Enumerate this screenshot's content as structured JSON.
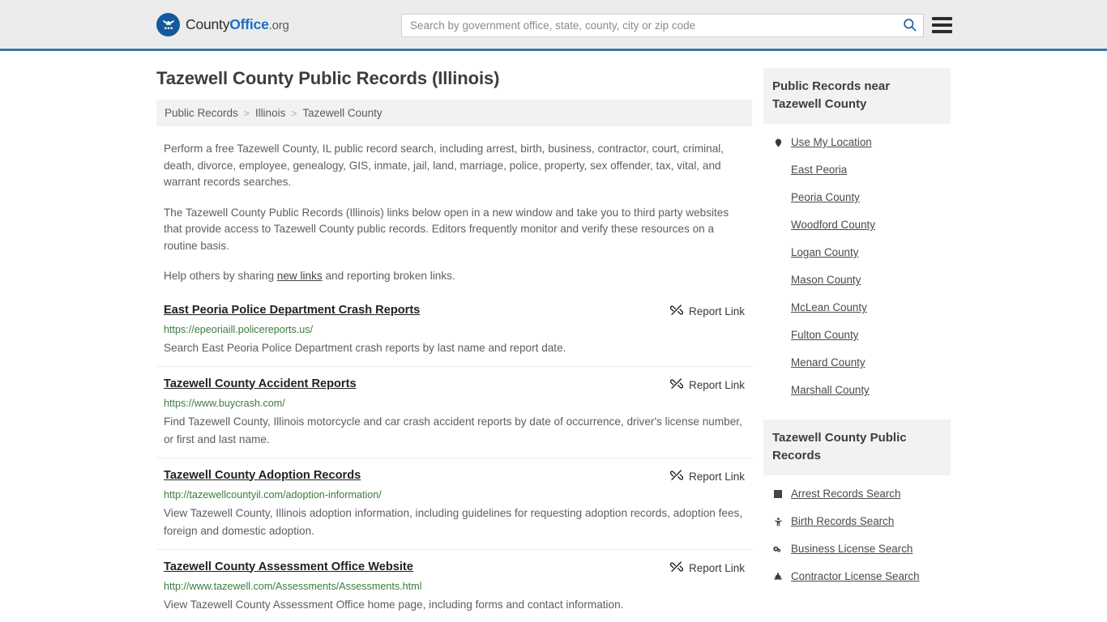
{
  "header": {
    "logo": {
      "icon": "eagle-shield-icon",
      "text_county": "County",
      "text_office": "Office",
      "text_tld": ".org"
    },
    "search": {
      "placeholder": "Search by government office, state, county, city or zip code",
      "value": "",
      "search_icon": "search-icon"
    },
    "menu_icon": "hamburger-menu-icon"
  },
  "main": {
    "title": "Tazewell County Public Records (Illinois)",
    "breadcrumb": [
      {
        "label": "Public Records"
      },
      {
        "label": "Illinois"
      },
      {
        "label": "Tazewell County"
      }
    ],
    "breadcrumb_separator": ">",
    "intro": {
      "p1": "Perform a free Tazewell County, IL public record search, including arrest, birth, business, contractor, court, criminal, death, divorce, employee, genealogy, GIS, inmate, jail, land, marriage, police, property, sex offender, tax, vital, and warrant records searches.",
      "p2": "The Tazewell County Public Records (Illinois) links below open in a new window and take you to third party websites that provide access to Tazewell County public records. Editors frequently monitor and verify these resources on a routine basis.",
      "p3_before": "Help others by sharing ",
      "p3_link": "new links",
      "p3_after": " and reporting broken links."
    },
    "report_link_label": "Report Link",
    "report_link_icon": "broken-link-icon",
    "results": [
      {
        "title": "East Peoria Police Department Crash Reports",
        "url": "https://epeoriaill.policereports.us/",
        "description": "Search East Peoria Police Department crash reports by last name and report date."
      },
      {
        "title": "Tazewell County Accident Reports",
        "url": "https://www.buycrash.com/",
        "description": "Find Tazewell County, Illinois motorcycle and car crash accident reports by date of occurrence, driver's license number, or first and last name."
      },
      {
        "title": "Tazewell County Adoption Records",
        "url": "http://tazewellcountyil.com/adoption-information/",
        "description": "View Tazewell County, Illinois adoption information, including guidelines for requesting adoption records, adoption fees, foreign and domestic adoption."
      },
      {
        "title": "Tazewell County Assessment Office Website",
        "url": "http://www.tazewell.com/Assessments/Assessments.html",
        "description": "View Tazewell County Assessment Office home page, including forms and contact information."
      }
    ]
  },
  "sidebar": {
    "near_box": {
      "heading": "Public Records near Tazewell County",
      "items": [
        {
          "label": "Use My Location",
          "icon": "map-pin-icon"
        },
        {
          "label": "East Peoria",
          "icon": ""
        },
        {
          "label": "Peoria County",
          "icon": ""
        },
        {
          "label": "Woodford County",
          "icon": ""
        },
        {
          "label": "Logan County",
          "icon": ""
        },
        {
          "label": "Mason County",
          "icon": ""
        },
        {
          "label": "McLean County",
          "icon": ""
        },
        {
          "label": "Fulton County",
          "icon": ""
        },
        {
          "label": "Menard County",
          "icon": ""
        },
        {
          "label": "Marshall County",
          "icon": ""
        }
      ]
    },
    "records_box": {
      "heading": "Tazewell County Public Records",
      "items": [
        {
          "label": "Arrest Records Search",
          "icon": "fingerprint-square-icon"
        },
        {
          "label": "Birth Records Search",
          "icon": "child-icon"
        },
        {
          "label": "Business License Search",
          "icon": "gears-icon"
        },
        {
          "label": "Contractor License Search",
          "icon": "hard-hat-icon"
        }
      ]
    }
  },
  "colors": {
    "header_bg": "#ececec",
    "header_rule": "#3f77a7",
    "brand_blue": "#1b6fc4",
    "logo_circle": "#15599c",
    "url_green": "#3d7c3d",
    "panel_gray": "#f2f2f2"
  }
}
